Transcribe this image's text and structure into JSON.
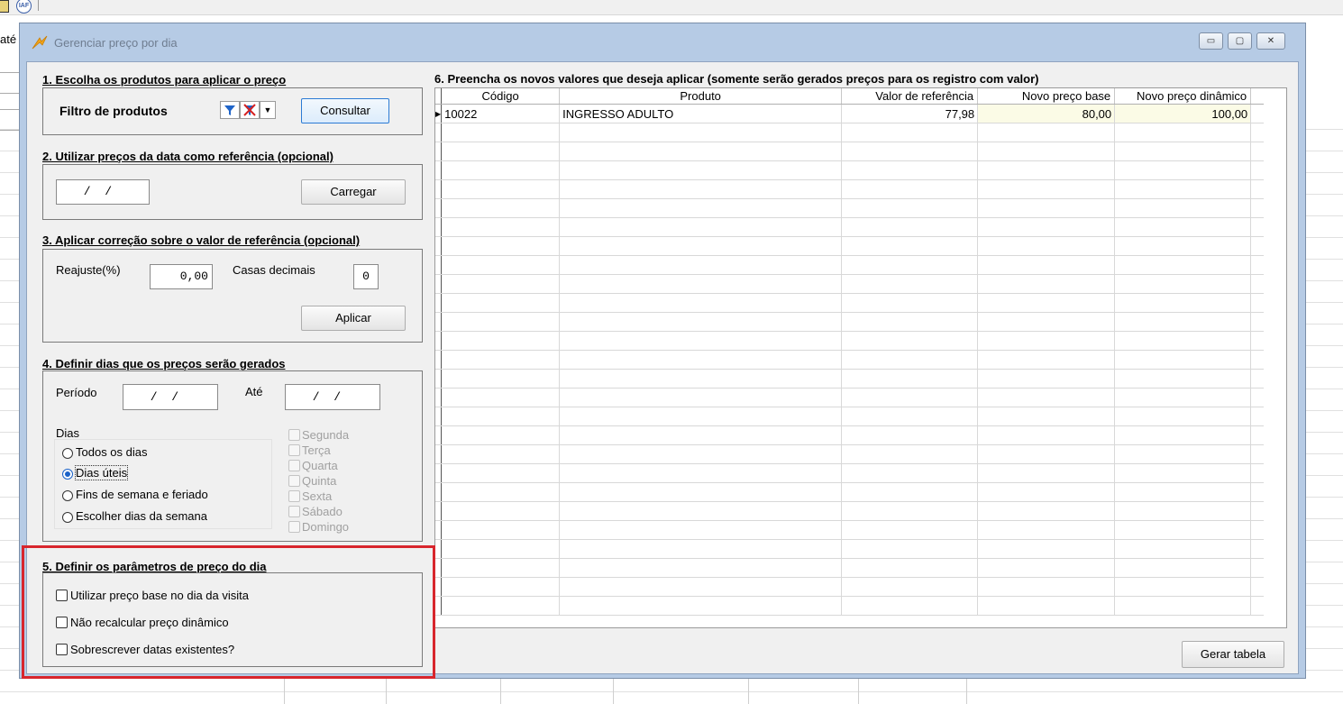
{
  "background": {
    "label_ate": "até"
  },
  "dialog": {
    "title": "Gerenciar preço por dia",
    "window_buttons": {
      "minimize": "▭",
      "maximize": "▢",
      "close": "✕"
    }
  },
  "section1": {
    "title": "1. Escolha os produtos para aplicar o preço",
    "filter_label": "Filtro de produtos",
    "consult_button": "Consultar"
  },
  "section2": {
    "title": "2. Utilizar preços da data como referência (opcional)",
    "date_value": " /  /",
    "load_button": "Carregar"
  },
  "section3": {
    "title": "3. Aplicar correção sobre o valor de referência (opcional)",
    "adjust_label": "Reajuste(%)",
    "adjust_value": "0,00",
    "decimals_label": "Casas decimais",
    "decimals_value": "0",
    "apply_button": "Aplicar"
  },
  "section4": {
    "title": "4. Definir dias que os preços serão gerados",
    "period_label": "Período",
    "period_from": " /  /",
    "until_label": "Até",
    "period_to": " /  /",
    "days_label": "Dias",
    "radio_options": [
      "Todos os dias",
      "Dias úteis",
      "Fins de semana e feriado",
      "Escolher dias da semana"
    ],
    "selected_radio": "Dias úteis",
    "weekdays": [
      "Segunda",
      "Terça",
      "Quarta",
      "Quinta",
      "Sexta",
      "Sábado",
      "Domingo"
    ]
  },
  "section5": {
    "title": "5. Definir os parâmetros de preço do dia",
    "options": [
      "Utilizar preço base no dia da visita",
      "Não recalcular preço dinâmico",
      "Sobrescrever datas existentes?"
    ]
  },
  "section6": {
    "title": "6. Preencha os novos valores que deseja aplicar (somente serão gerados preços para os registro com valor)",
    "columns": [
      "Código",
      "Produto",
      "Valor de referência",
      "Novo preço base",
      "Novo preço dinâmico"
    ],
    "rows": [
      {
        "codigo": "10022",
        "produto": "INGRESSO ADULTO",
        "valor_referencia": "77,98",
        "novo_preco_base": "80,00",
        "novo_preco_dinamico": "100,00"
      }
    ]
  },
  "footer": {
    "generate_button": "Gerar tabela"
  },
  "colors": {
    "highlight_border": "#d8262d",
    "title_bar": "#b6cbe5",
    "focus_button": "#2c7bd4"
  }
}
